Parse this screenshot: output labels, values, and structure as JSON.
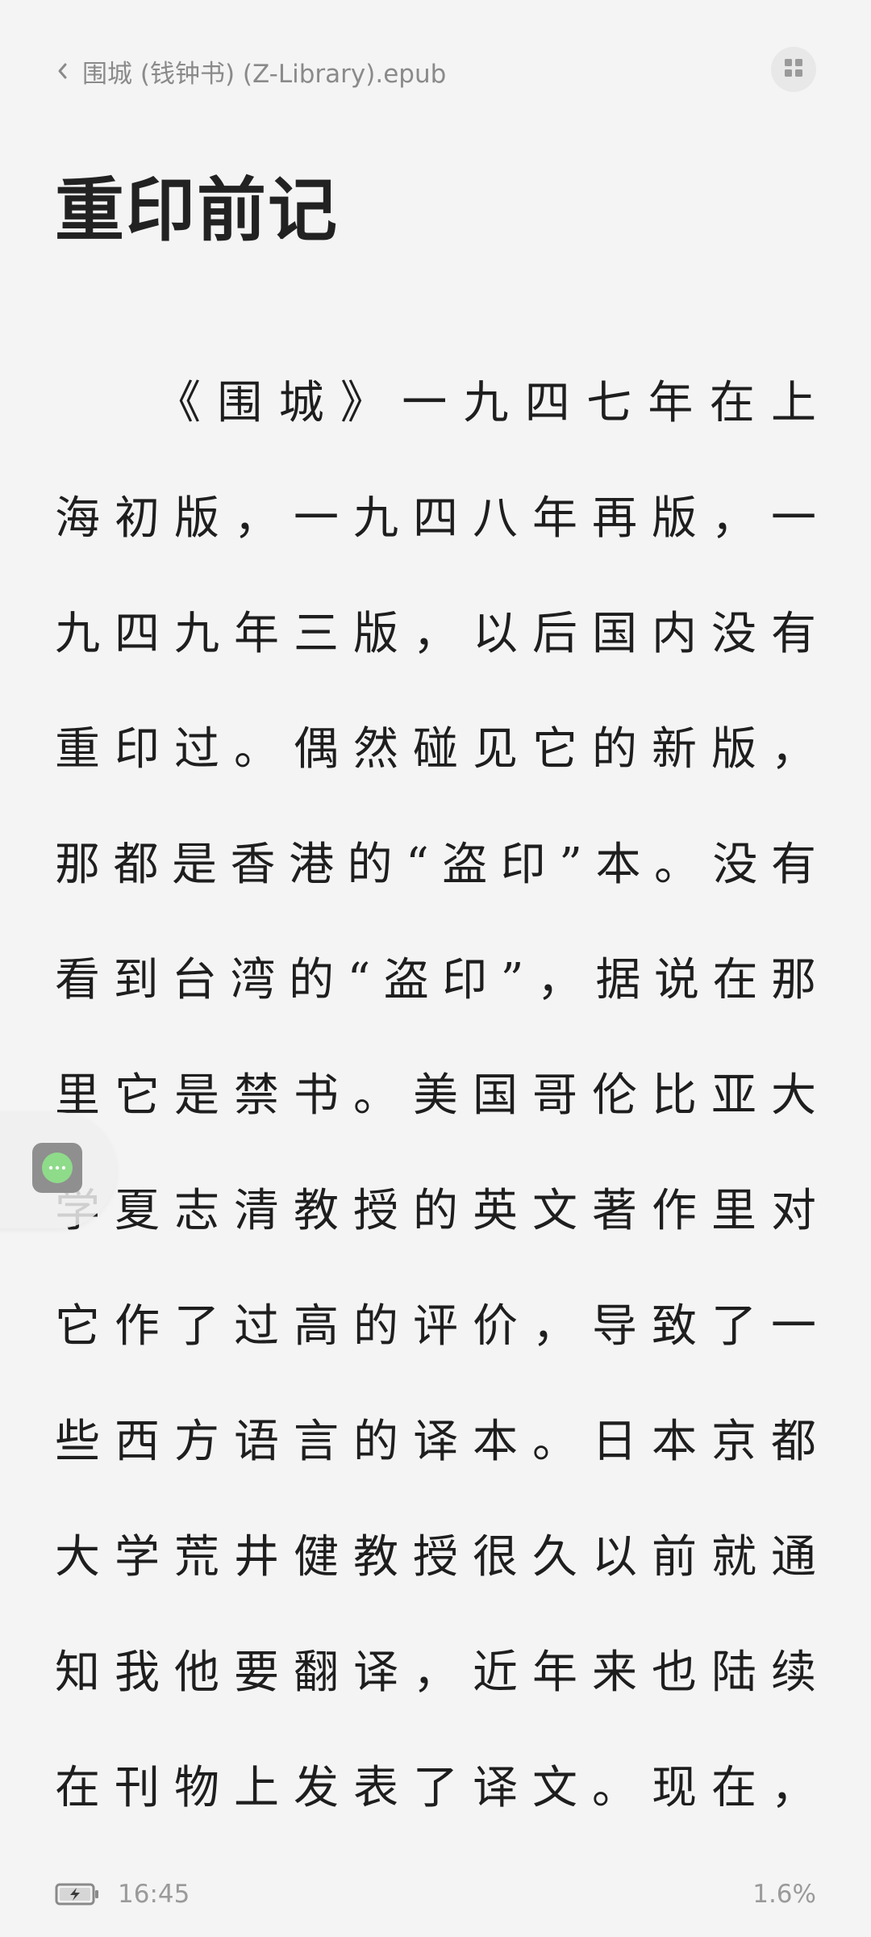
{
  "header": {
    "book_title": "围城 (钱钟书) (Z-Library).epub",
    "back_icon": "chevron-left-icon",
    "menu_icon": "grid-icon"
  },
  "chapter": {
    "title": "重印前记"
  },
  "body": {
    "lines": [
      "《围城》一九四七年在上",
      "海初版，一九四八年再版，一",
      "九四九年三版，以后国内没有",
      "重印过。偶然碰见它的新版，",
      "那都是香港的“盗印”本。没有",
      "看到台湾的“盗印”，据说在那",
      "里它是禁书。美国哥伦比亚大",
      "学夏志清教授的英文著作里对",
      "它作了过高的评价，导致了一",
      "些西方语言的译本。日本京都",
      "大学荒井健教授很久以前就通",
      "知我他要翻译，近年来也陆续",
      "在刊物上发表了译文。现在，"
    ]
  },
  "floating": {
    "icon": "more-dots-icon",
    "accent": "#8edb8a"
  },
  "footer": {
    "battery_icon": "battery-charging-icon",
    "time": "16:45",
    "progress": "1.6%"
  }
}
